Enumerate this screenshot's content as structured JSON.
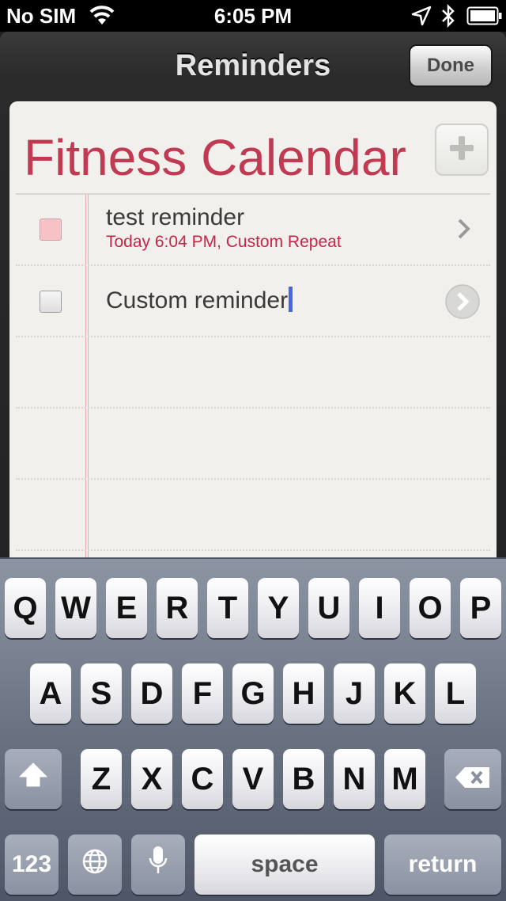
{
  "status": {
    "carrier": "No SIM",
    "time": "6:05 PM",
    "icons": [
      "wifi-icon",
      "location-icon",
      "bluetooth-icon",
      "battery-icon"
    ]
  },
  "nav": {
    "title": "Reminders",
    "done_label": "Done"
  },
  "list": {
    "title": "Fitness Calendar",
    "accent_color": "#c03a52",
    "items": [
      {
        "title": "test reminder",
        "subtitle": "Today 6:04 PM, Custom Repeat",
        "checkbox_state": "pink"
      },
      {
        "title": "Custom reminder",
        "subtitle": "",
        "checkbox_state": "empty",
        "editing": true
      }
    ]
  },
  "keyboard": {
    "row1": [
      "Q",
      "W",
      "E",
      "R",
      "T",
      "Y",
      "U",
      "I",
      "O",
      "P"
    ],
    "row2": [
      "A",
      "S",
      "D",
      "F",
      "G",
      "H",
      "J",
      "K",
      "L"
    ],
    "row3": [
      "Z",
      "X",
      "C",
      "V",
      "B",
      "N",
      "M"
    ],
    "numbers_label": "123",
    "space_label": "space",
    "return_label": "return",
    "special_icons": [
      "shift-icon",
      "backspace-icon",
      "globe-icon",
      "microphone-icon"
    ]
  }
}
